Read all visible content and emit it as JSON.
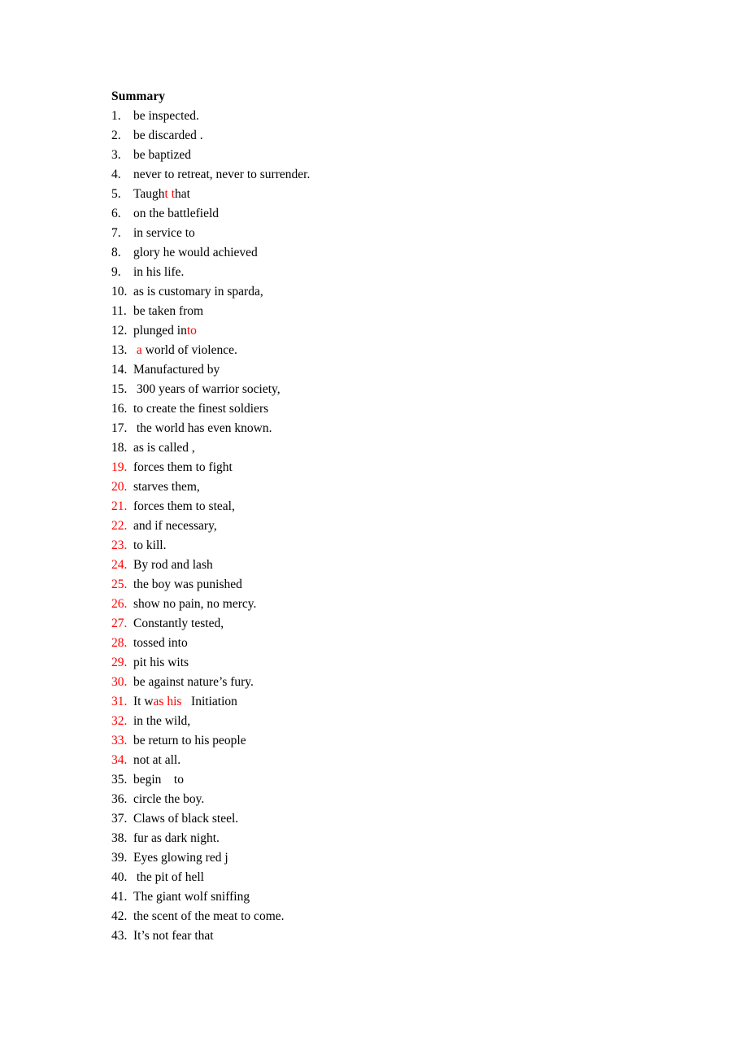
{
  "document": {
    "heading": "Summary",
    "accent_color": "#FF0000",
    "text_color": "#000000",
    "background_color": "#FFFFFF"
  },
  "items": [
    {
      "number": "1.",
      "number_color": "#000000",
      "runs": [
        {
          "text": "be inspected.",
          "color": "#000000"
        }
      ]
    },
    {
      "number": "2.",
      "number_color": "#000000",
      "runs": [
        {
          "text": "be discarded .",
          "color": "#000000"
        }
      ]
    },
    {
      "number": "3.",
      "number_color": "#000000",
      "runs": [
        {
          "text": "be baptized",
          "color": "#000000"
        }
      ]
    },
    {
      "number": "4.",
      "number_color": "#000000",
      "runs": [
        {
          "text": "never to retreat, never to surrender.",
          "color": "#000000"
        }
      ]
    },
    {
      "number": "5.",
      "number_color": "#000000",
      "runs": [
        {
          "text": "Taugh",
          "color": "#000000"
        },
        {
          "text": "t t",
          "color": "#FF0000"
        },
        {
          "text": "hat",
          "color": "#000000"
        }
      ]
    },
    {
      "number": "6.",
      "number_color": "#000000",
      "runs": [
        {
          "text": "on the battlefield",
          "color": "#000000"
        }
      ]
    },
    {
      "number": "7.",
      "number_color": "#000000",
      "runs": [
        {
          "text": "in service to",
          "color": "#000000"
        }
      ]
    },
    {
      "number": "8.",
      "number_color": "#000000",
      "runs": [
        {
          "text": "glory he would achieved",
          "color": "#000000"
        }
      ]
    },
    {
      "number": "9.",
      "number_color": "#000000",
      "runs": [
        {
          "text": "in his life.",
          "color": "#000000"
        }
      ]
    },
    {
      "number": "10.",
      "number_color": "#000000",
      "runs": [
        {
          "text": "as is customary in sparda,",
          "color": "#000000"
        }
      ]
    },
    {
      "number": "11.",
      "number_color": "#000000",
      "runs": [
        {
          "text": "be taken from",
          "color": "#000000"
        }
      ]
    },
    {
      "number": "12.",
      "number_color": "#000000",
      "runs": [
        {
          "text": "plunged in",
          "color": "#000000"
        },
        {
          "text": "to",
          "color": "#FF0000"
        }
      ]
    },
    {
      "number": "13.",
      "number_color": "#000000",
      "runs": [
        {
          "text": " a",
          "color": "#FF0000"
        },
        {
          "text": " world of violence.",
          "color": "#000000"
        }
      ]
    },
    {
      "number": "14.",
      "number_color": "#000000",
      "runs": [
        {
          "text": "Manufactured by",
          "color": "#000000"
        }
      ]
    },
    {
      "number": "15.",
      "number_color": "#000000",
      "runs": [
        {
          "text": " 300 years of warrior society,",
          "color": "#000000"
        }
      ]
    },
    {
      "number": "16.",
      "number_color": "#000000",
      "runs": [
        {
          "text": "to create the finest soldiers",
          "color": "#000000"
        }
      ]
    },
    {
      "number": "17.",
      "number_color": "#000000",
      "runs": [
        {
          "text": " the world has even known.",
          "color": "#000000"
        }
      ]
    },
    {
      "number": "18.",
      "number_color": "#000000",
      "runs": [
        {
          "text": "as is called ,",
          "color": "#000000"
        }
      ]
    },
    {
      "number": "19.",
      "number_color": "#FF0000",
      "runs": [
        {
          "text": "forces them to fight",
          "color": "#000000"
        }
      ]
    },
    {
      "number": "20.",
      "number_color": "#FF0000",
      "runs": [
        {
          "text": "starves them,",
          "color": "#000000"
        }
      ]
    },
    {
      "number": "21.",
      "number_color": "#FF0000",
      "runs": [
        {
          "text": "forces them to steal,",
          "color": "#000000"
        }
      ]
    },
    {
      "number": "22.",
      "number_color": "#FF0000",
      "runs": [
        {
          "text": "and if necessary,",
          "color": "#000000"
        }
      ]
    },
    {
      "number": "23.",
      "number_color": "#FF0000",
      "runs": [
        {
          "text": "to kill.",
          "color": "#000000"
        }
      ]
    },
    {
      "number": "24.",
      "number_color": "#FF0000",
      "runs": [
        {
          "text": "By rod and lash",
          "color": "#000000"
        }
      ]
    },
    {
      "number": "25.",
      "number_color": "#FF0000",
      "runs": [
        {
          "text": "the boy was punished",
          "color": "#000000"
        }
      ]
    },
    {
      "number": "26.",
      "number_color": "#FF0000",
      "runs": [
        {
          "text": "show no pain, no mercy.",
          "color": "#000000"
        }
      ]
    },
    {
      "number": "27.",
      "number_color": "#FF0000",
      "runs": [
        {
          "text": "Constantly tested,",
          "color": "#000000"
        }
      ]
    },
    {
      "number": "28.",
      "number_color": "#FF0000",
      "runs": [
        {
          "text": "tossed into",
          "color": "#000000"
        }
      ]
    },
    {
      "number": "29.",
      "number_color": "#FF0000",
      "runs": [
        {
          "text": "pit his wits",
          "color": "#000000"
        }
      ]
    },
    {
      "number": "30.",
      "number_color": "#FF0000",
      "runs": [
        {
          "text": "be against nature’s fury.",
          "color": "#000000"
        }
      ]
    },
    {
      "number": "31.",
      "number_color": "#FF0000",
      "runs": [
        {
          "text": "It w",
          "color": "#000000"
        },
        {
          "text": "as his",
          "color": "#FF0000"
        },
        {
          "text": "   Initiation",
          "color": "#000000"
        }
      ]
    },
    {
      "number": "32.",
      "number_color": "#FF0000",
      "runs": [
        {
          "text": "in the wild,",
          "color": "#000000"
        }
      ]
    },
    {
      "number": "33.",
      "number_color": "#FF0000",
      "runs": [
        {
          "text": "be return to his people",
          "color": "#000000"
        }
      ]
    },
    {
      "number": "34.",
      "number_color": "#FF0000",
      "runs": [
        {
          "text": "not at all.",
          "color": "#000000"
        }
      ]
    },
    {
      "number": "35.",
      "number_color": "#000000",
      "runs": [
        {
          "text": "begin    to",
          "color": "#000000"
        }
      ]
    },
    {
      "number": "36.",
      "number_color": "#000000",
      "runs": [
        {
          "text": "circle the boy.",
          "color": "#000000"
        }
      ]
    },
    {
      "number": "37.",
      "number_color": "#000000",
      "runs": [
        {
          "text": "Claws of black steel.",
          "color": "#000000"
        }
      ]
    },
    {
      "number": "38.",
      "number_color": "#000000",
      "runs": [
        {
          "text": "fur as dark night.",
          "color": "#000000"
        }
      ]
    },
    {
      "number": "39.",
      "number_color": "#000000",
      "runs": [
        {
          "text": "Eyes glowing red j",
          "color": "#000000"
        }
      ]
    },
    {
      "number": "40.",
      "number_color": "#000000",
      "runs": [
        {
          "text": " the pit of hell",
          "color": "#000000"
        }
      ]
    },
    {
      "number": "41.",
      "number_color": "#000000",
      "runs": [
        {
          "text": "The giant wolf sniffing",
          "color": "#000000"
        }
      ]
    },
    {
      "number": "42.",
      "number_color": "#000000",
      "runs": [
        {
          "text": "the scent of the meat to come.",
          "color": "#000000"
        }
      ]
    },
    {
      "number": "43.",
      "number_color": "#000000",
      "runs": [
        {
          "text": "It’s not fear that",
          "color": "#000000"
        }
      ]
    }
  ]
}
